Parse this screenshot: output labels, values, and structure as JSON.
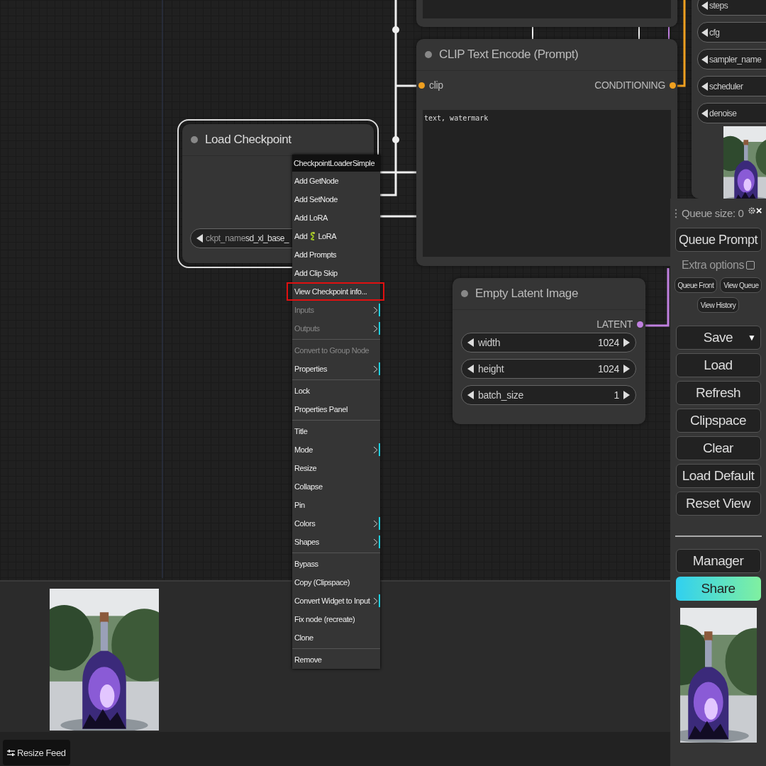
{
  "canvas": {
    "sampler_widgets": [
      {
        "name": "steps"
      },
      {
        "name": "cfg"
      },
      {
        "name": "sampler_name"
      },
      {
        "name": "scheduler"
      },
      {
        "name": "denoise"
      }
    ],
    "load_checkpoint": {
      "title": "Load Checkpoint",
      "selected": true,
      "widget": {
        "name": "ckpt_name",
        "value": "sd_xl_base_"
      }
    },
    "clip_text_encode": {
      "title": "CLIP Text Encode (Prompt)",
      "input": "clip",
      "output": "CONDITIONING",
      "text": "text, watermark"
    },
    "empty_latent": {
      "title": "Empty Latent Image",
      "output": "LATENT",
      "widgets": [
        {
          "name": "width",
          "value": "1024"
        },
        {
          "name": "height",
          "value": "1024"
        },
        {
          "name": "batch_size",
          "value": "1"
        }
      ]
    }
  },
  "context_menu": {
    "title": "CheckpointLoaderSimple",
    "sections": [
      [
        {
          "kind": "text",
          "label": "Add GetNode",
          "disabled": false,
          "submenu": false,
          "highlighted": false
        },
        {
          "kind": "text",
          "label": "Add SetNode",
          "disabled": false,
          "submenu": false,
          "highlighted": false
        },
        {
          "kind": "text",
          "label": "Add LoRA",
          "disabled": false,
          "submenu": false,
          "highlighted": false
        },
        {
          "kind": "icon",
          "label": "Add",
          "label_after": "LoRA",
          "disabled": false,
          "submenu": false,
          "highlighted": false
        },
        {
          "kind": "text",
          "label": "Add Prompts",
          "disabled": false,
          "submenu": false,
          "highlighted": false
        },
        {
          "kind": "text",
          "label": "Add Clip Skip",
          "disabled": false,
          "submenu": false,
          "highlighted": false
        },
        {
          "kind": "text",
          "label": "View Checkpoint info...",
          "disabled": false,
          "submenu": false,
          "highlighted": true
        },
        {
          "kind": "text",
          "label": "Inputs",
          "disabled": true,
          "submenu": true,
          "highlighted": false
        },
        {
          "kind": "text",
          "label": "Outputs",
          "disabled": true,
          "submenu": true,
          "highlighted": false
        }
      ],
      [
        {
          "kind": "text",
          "label": "Convert to Group Node",
          "disabled": true,
          "submenu": false,
          "highlighted": false
        },
        {
          "kind": "text",
          "label": "Properties",
          "disabled": false,
          "submenu": true,
          "highlighted": false
        }
      ],
      [
        {
          "kind": "text",
          "label": "Lock",
          "disabled": false,
          "submenu": false,
          "highlighted": false
        },
        {
          "kind": "text",
          "label": "Properties Panel",
          "disabled": false,
          "submenu": false,
          "highlighted": false
        }
      ],
      [
        {
          "kind": "text",
          "label": "Title",
          "disabled": false,
          "submenu": false,
          "highlighted": false
        },
        {
          "kind": "text",
          "label": "Mode",
          "disabled": false,
          "submenu": true,
          "highlighted": false
        },
        {
          "kind": "text",
          "label": "Resize",
          "disabled": false,
          "submenu": false,
          "highlighted": false
        },
        {
          "kind": "text",
          "label": "Collapse",
          "disabled": false,
          "submenu": false,
          "highlighted": false
        },
        {
          "kind": "text",
          "label": "Pin",
          "disabled": false,
          "submenu": false,
          "highlighted": false
        },
        {
          "kind": "text",
          "label": "Colors",
          "disabled": false,
          "submenu": true,
          "highlighted": false
        },
        {
          "kind": "text",
          "label": "Shapes",
          "disabled": false,
          "submenu": true,
          "highlighted": false
        }
      ],
      [
        {
          "kind": "text",
          "label": "Bypass",
          "disabled": false,
          "submenu": false,
          "highlighted": false
        },
        {
          "kind": "text",
          "label": "Copy (Clipspace)",
          "disabled": false,
          "submenu": false,
          "highlighted": false
        },
        {
          "kind": "text",
          "label": "Convert Widget to Input",
          "disabled": false,
          "submenu": true,
          "highlighted": false
        },
        {
          "kind": "text",
          "label": "Fix node (recreate)",
          "disabled": false,
          "submenu": false,
          "highlighted": false
        },
        {
          "kind": "text",
          "label": "Clone",
          "disabled": false,
          "submenu": false,
          "highlighted": false
        }
      ],
      [
        {
          "kind": "text",
          "label": "Remove",
          "disabled": false,
          "submenu": false,
          "highlighted": false
        }
      ]
    ]
  },
  "side_panel": {
    "queue_size": "Queue size: 0",
    "close": "×",
    "queue_button": "Queue Prompt",
    "extra_options": {
      "label": "Extra options",
      "checked": false
    },
    "small_buttons": [
      "Queue Front",
      "View Queue",
      "View History"
    ],
    "save": "Save",
    "save_caret": "▼",
    "buttons": [
      "Load",
      "Refresh",
      "Clipspace",
      "Clear",
      "Load Default",
      "Reset View"
    ],
    "manager": "Manager",
    "share": "Share",
    "preview": {
      "kind": "picture"
    }
  },
  "feed": {
    "image": {
      "kind": "picture"
    },
    "resize_button": "Resize Feed"
  }
}
